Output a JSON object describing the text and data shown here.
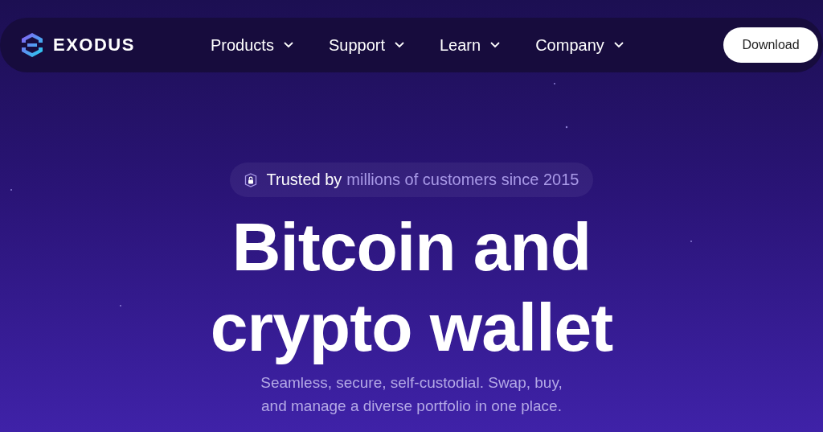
{
  "brand": {
    "name": "EXODUS"
  },
  "nav": [
    {
      "label": "Products",
      "has_menu": true
    },
    {
      "label": "Support",
      "has_menu": true
    },
    {
      "label": "Learn",
      "has_menu": true
    },
    {
      "label": "Company",
      "has_menu": true
    }
  ],
  "download_button": "Download",
  "badge": {
    "lead": "Trusted by",
    "text": "millions of customers since 2015"
  },
  "headline": [
    "Bitcoin and",
    "crypto wallet"
  ],
  "subtitle": [
    "Seamless, secure, self-custodial. Swap, buy,",
    "and manage a diverse portfolio in one place."
  ]
}
